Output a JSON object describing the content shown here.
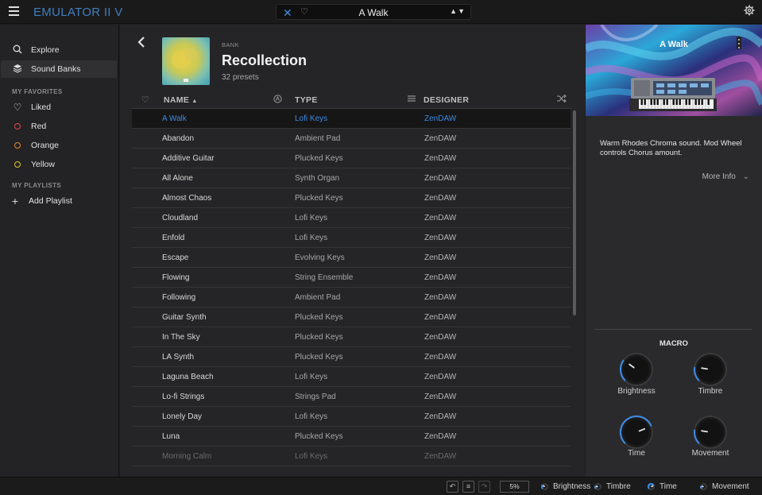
{
  "app": {
    "title": "EMULATOR II V"
  },
  "preset_bar": {
    "name": "A Walk",
    "close_icon": "close-icon",
    "heart_icon": "heart-icon",
    "nav_arrows": "▲▼"
  },
  "sidebar": {
    "nav": [
      {
        "label": "Explore",
        "icon": "search-icon"
      },
      {
        "label": "Sound Banks",
        "icon": "layers-icon",
        "active": true
      }
    ],
    "favorites_heading": "MY FAVORITES",
    "favorites": [
      {
        "label": "Liked",
        "icon": "heart-icon"
      },
      {
        "label": "Red",
        "color": "#e04848"
      },
      {
        "label": "Orange",
        "color": "#e08a2c"
      },
      {
        "label": "Yellow",
        "color": "#e0c12c"
      }
    ],
    "playlists_heading": "MY PLAYLISTS",
    "add_playlist": "Add Playlist"
  },
  "bank": {
    "kind": "BANK",
    "title": "Recollection",
    "count": "32 presets"
  },
  "table": {
    "headers": {
      "name": "NAME",
      "type": "TYPE",
      "designer": "DESIGNER",
      "sort_indicator": "▲"
    },
    "rows": [
      {
        "name": "A Walk",
        "type": "Lofi Keys",
        "designer": "ZenDAW",
        "selected": true
      },
      {
        "name": "Abandon",
        "type": "Ambient Pad",
        "designer": "ZenDAW"
      },
      {
        "name": "Additive Guitar",
        "type": "Plucked Keys",
        "designer": "ZenDAW"
      },
      {
        "name": "All Alone",
        "type": "Synth Organ",
        "designer": "ZenDAW"
      },
      {
        "name": "Almost Chaos",
        "type": "Plucked Keys",
        "designer": "ZenDAW"
      },
      {
        "name": "Cloudland",
        "type": "Lofi Keys",
        "designer": "ZenDAW"
      },
      {
        "name": "Enfold",
        "type": "Lofi Keys",
        "designer": "ZenDAW"
      },
      {
        "name": "Escape",
        "type": "Evolving Keys",
        "designer": "ZenDAW"
      },
      {
        "name": "Flowing",
        "type": "String Ensemble",
        "designer": "ZenDAW"
      },
      {
        "name": "Following",
        "type": "Ambient Pad",
        "designer": "ZenDAW"
      },
      {
        "name": "Guitar Synth",
        "type": "Plucked Keys",
        "designer": "ZenDAW"
      },
      {
        "name": "In The Sky",
        "type": "Plucked Keys",
        "designer": "ZenDAW"
      },
      {
        "name": "LA Synth",
        "type": "Plucked Keys",
        "designer": "ZenDAW"
      },
      {
        "name": "Laguna Beach",
        "type": "Lofi Keys",
        "designer": "ZenDAW"
      },
      {
        "name": "Lo-fi Strings",
        "type": "Strings Pad",
        "designer": "ZenDAW"
      },
      {
        "name": "Lonely Day",
        "type": "Lofi Keys",
        "designer": "ZenDAW"
      },
      {
        "name": "Luna",
        "type": "Plucked Keys",
        "designer": "ZenDAW"
      },
      {
        "name": "Morning Calm",
        "type": "Lofi Keys",
        "designer": "ZenDAW",
        "faded": true
      }
    ]
  },
  "details": {
    "preset_name": "A Walk",
    "description": "Warm Rhodes Chroma sound. Mod Wheel controls Chorus amount.",
    "more_info": "More Info"
  },
  "macro": {
    "title": "MACRO",
    "knobs": [
      {
        "label": "Brightness",
        "value": 0.3
      },
      {
        "label": "Timbre",
        "value": 0.2
      },
      {
        "label": "Time",
        "value": 0.75
      },
      {
        "label": "Movement",
        "value": 0.2
      }
    ]
  },
  "bottombar": {
    "zoom": "5%",
    "undo_icon": "undo-icon",
    "history_icon": "history-icon",
    "redo_icon": "redo-icon",
    "mini_knobs": [
      {
        "label": "Brightness"
      },
      {
        "label": "Timbre"
      },
      {
        "label": "Time"
      },
      {
        "label": "Movement"
      }
    ]
  },
  "colors": {
    "accent": "#3d8ae0",
    "title": "#3f7fbf"
  }
}
